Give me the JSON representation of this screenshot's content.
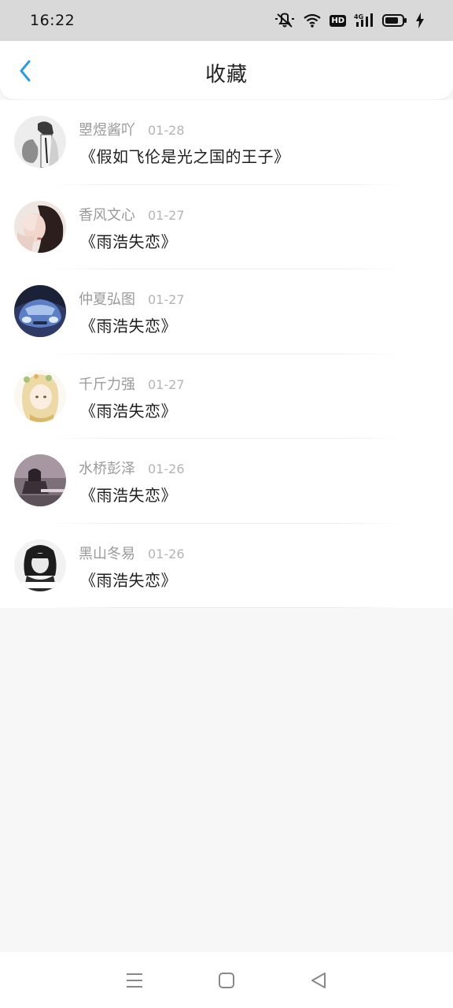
{
  "status_bar": {
    "time": "16:22",
    "hd_label": "HD",
    "network_label": "4G",
    "icons": [
      "mute-icon",
      "wifi-icon",
      "hd-icon",
      "signal-icon",
      "battery-icon",
      "charging-icon"
    ]
  },
  "header": {
    "title": "收藏",
    "back_icon": "chevron-left-icon",
    "accent_color": "#2a9de0"
  },
  "favorites": [
    {
      "user": "曌煜酱吖",
      "date": "01-28",
      "title": "《假如飞伦是光之国的王子》"
    },
    {
      "user": "香风文心",
      "date": "01-27",
      "title": "《雨浩失恋》"
    },
    {
      "user": "仲夏弘图",
      "date": "01-27",
      "title": "《雨浩失恋》"
    },
    {
      "user": "千斤力强",
      "date": "01-27",
      "title": "《雨浩失恋》"
    },
    {
      "user": "水桥彭泽",
      "date": "01-26",
      "title": "《雨浩失恋》"
    },
    {
      "user": "黑山冬易",
      "date": "01-26",
      "title": "《雨浩失恋》"
    }
  ],
  "nav_bar": {
    "icons": [
      "menu-icon",
      "home-icon",
      "back-triangle-icon"
    ]
  }
}
